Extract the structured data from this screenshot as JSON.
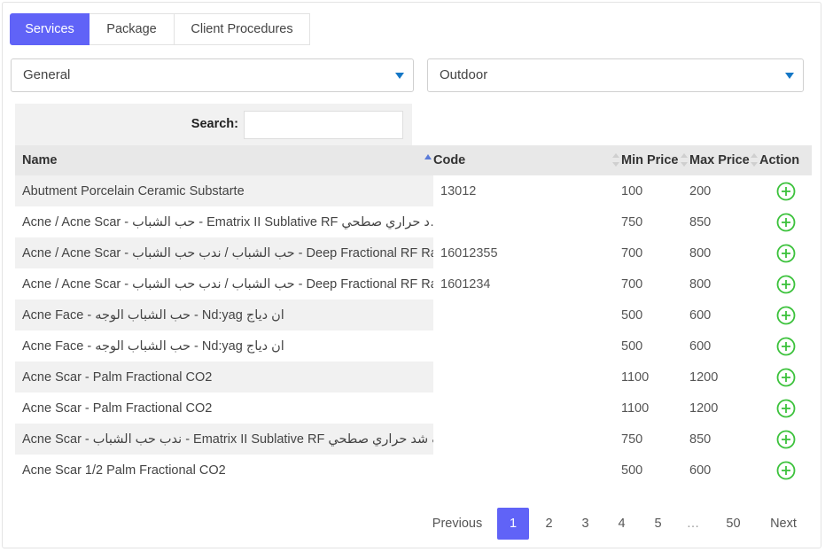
{
  "tabs": [
    {
      "label": "Services",
      "active": true
    },
    {
      "label": "Package",
      "active": false
    },
    {
      "label": "Client Procedures",
      "active": false
    }
  ],
  "filters": {
    "category": "General",
    "visit_type": "Outdoor"
  },
  "search": {
    "label": "Search:",
    "value": ""
  },
  "table": {
    "headers": {
      "name": "Name",
      "code": "Code",
      "min_price": "Min Price",
      "max_price": "Max Price",
      "action": "Action"
    },
    "sorted_by": "name",
    "rows": [
      {
        "name": "Abutment Porcelain Ceramic Substarte",
        "code": "13012",
        "min": "100",
        "max": "200"
      },
      {
        "name": "Acne / Acne Scar - حب الشباب - Ematrix II Sublative RF د حراري صطحي…",
        "code": "",
        "min": "750",
        "max": "850"
      },
      {
        "name": "Acne / Acne Scar - حب الشباب / ندب حب الشباب - Deep Fractional RF Ra…",
        "code": "16012355",
        "min": "700",
        "max": "800"
      },
      {
        "name": "Acne / Acne Scar - حب الشباب / ندب حب الشباب - Deep Fractional RF Ra…",
        "code": "1601234",
        "min": "700",
        "max": "800"
      },
      {
        "name": "Acne Face - حب الشباب الوجه - Nd:yag ان دياج",
        "code": "",
        "min": "500",
        "max": "600"
      },
      {
        "name": "Acne Face - حب الشباب الوجه - Nd:yag ان دياج",
        "code": "",
        "min": "500",
        "max": "600"
      },
      {
        "name": "Acne Scar - Palm Fractional CO2",
        "code": "",
        "min": "1100",
        "max": "1200"
      },
      {
        "name": "Acne Scar - Palm Fractional CO2",
        "code": "",
        "min": "1100",
        "max": "1200"
      },
      {
        "name": "Acne Scar - ندب حب الشباب - Ematrix II Sublative RF ف شد حراري صطحي…",
        "code": "",
        "min": "750",
        "max": "850"
      },
      {
        "name": "Acne Scar 1/2 Palm Fractional CO2",
        "code": "",
        "min": "500",
        "max": "600"
      }
    ],
    "action_icon": "plus-circle-icon"
  },
  "pagination": {
    "previous": "Previous",
    "pages": [
      "1",
      "2",
      "3",
      "4",
      "5"
    ],
    "ellipsis": "…",
    "last": "50",
    "next": "Next",
    "current": "1"
  },
  "colors": {
    "accent": "#6063f7",
    "action_green": "#3cc23c",
    "select_caret": "#1577c6"
  }
}
